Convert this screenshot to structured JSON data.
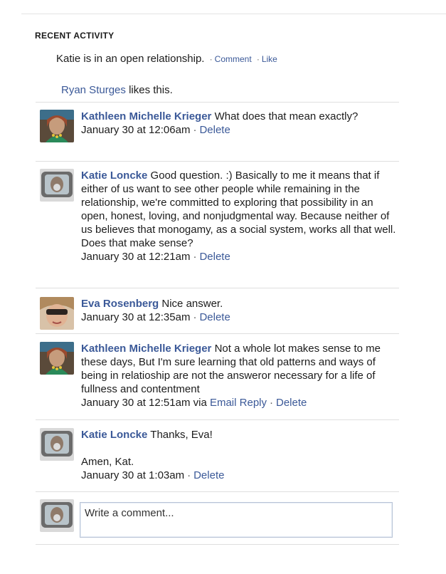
{
  "section_title": "RECENT ACTIVITY",
  "status": {
    "text": "Katie is in an open relationship.",
    "comment_label": "Comment",
    "like_label": "Like",
    "separator": "·"
  },
  "likes": {
    "name": "Ryan Sturges",
    "text": "likes this."
  },
  "comments": [
    {
      "author": "Kathleen Michelle Krieger",
      "text": "What does that mean exactly?",
      "time": "January 30 at 12:06am",
      "delete_label": "Delete"
    },
    {
      "author": "Katie Loncke",
      "text": "Good question. :) Basically to me it means that if either of us want to see other people while remaining in the relationship, we're committed to exploring that possibility in an open, honest, loving, and nonjudgmental way. Because neither of us believes that monogamy, as a social system, works all that well. Does that make sense?",
      "time": "January 30 at 12:21am",
      "delete_label": "Delete"
    },
    {
      "author": "Eva Rosenberg",
      "text": "Nice answer.",
      "time": "January 30 at 12:35am",
      "delete_label": "Delete"
    },
    {
      "author": "Kathleen Michelle Krieger",
      "text": "Not a whole lot makes sense to me these days, But I'm sure learning that old patterns and ways of being in relatioship are not the answeror necessary for a life of fullness and contentment",
      "time": "January 30 at 12:51am",
      "via_text": "via",
      "via_link": "Email Reply",
      "delete_label": "Delete"
    },
    {
      "author": "Katie Loncke",
      "text": "Thanks, Eva!",
      "extra": "Amen, Kat.",
      "time": "January 30 at 1:03am",
      "delete_label": "Delete"
    }
  ],
  "write_comment": {
    "placeholder": "Write a comment..."
  },
  "colors": {
    "link": "#3b5998",
    "divider": "#dfdfdf"
  }
}
